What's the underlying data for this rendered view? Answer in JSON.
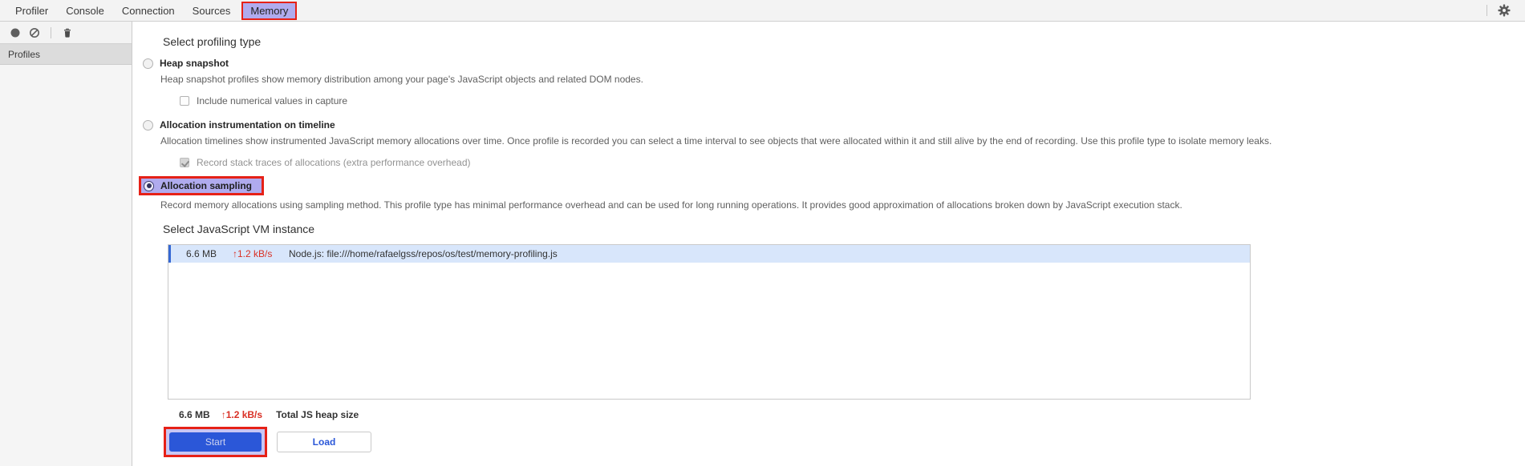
{
  "tabs": {
    "items": [
      {
        "label": "Profiler",
        "selected": false
      },
      {
        "label": "Console",
        "selected": false
      },
      {
        "label": "Connection",
        "selected": false
      },
      {
        "label": "Sources",
        "selected": false
      },
      {
        "label": "Memory",
        "selected": true,
        "annotated": true
      }
    ]
  },
  "toolbar": {
    "icons": [
      "record-icon",
      "clear-icon",
      "trash-icon"
    ],
    "settings_icon": "gear-icon"
  },
  "sidebar": {
    "header": "Profiles"
  },
  "main": {
    "profiling_type": {
      "heading": "Select profiling type",
      "options": [
        {
          "label": "Heap snapshot",
          "selected": false,
          "description": "Heap snapshot profiles show memory distribution among your page's JavaScript objects and related DOM nodes.",
          "child_checkbox": {
            "label": "Include numerical values in capture",
            "checked": false,
            "disabled": false
          }
        },
        {
          "label": "Allocation instrumentation on timeline",
          "selected": false,
          "description": "Allocation timelines show instrumented JavaScript memory allocations over time. Once profile is recorded you can select a time interval to see objects that were allocated within it and still alive by the end of recording. Use this profile type to isolate memory leaks.",
          "child_checkbox": {
            "label": "Record stack traces of allocations (extra performance overhead)",
            "checked": true,
            "disabled": true
          }
        },
        {
          "label": "Allocation sampling",
          "selected": true,
          "annotated": true,
          "description": "Record memory allocations using sampling method. This profile type has minimal performance overhead and can be used for long running operations. It provides good approximation of allocations broken down by JavaScript execution stack."
        }
      ]
    },
    "vm_instance": {
      "heading": "Select JavaScript VM instance",
      "rows": [
        {
          "size": "6.6 MB",
          "rate": "↑1.2 kB/s",
          "name": "Node.js: file:///home/rafaelgss/repos/os/test/memory-profiling.js",
          "selected": true
        }
      ],
      "total": {
        "size": "6.6 MB",
        "rate": "↑1.2 kB/s",
        "label": "Total JS heap size"
      }
    },
    "actions": {
      "start_label": "Start",
      "load_label": "Load"
    }
  },
  "colors": {
    "annotation_red": "#e62117",
    "highlight_lavender": "#b0abee",
    "primary_blue": "#2b57d8",
    "selected_row_blue": "#d8e6fb",
    "rate_red": "#d93025",
    "toolbar_gray": "#f3f3f3"
  }
}
